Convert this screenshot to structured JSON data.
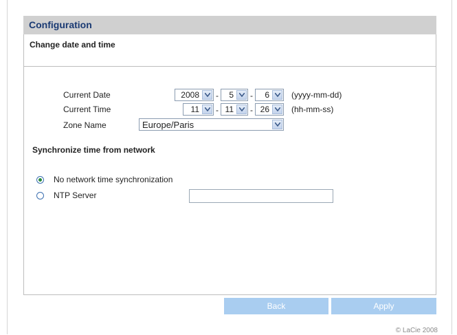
{
  "header": {
    "title": "Configuration"
  },
  "section": {
    "title": "Change date and time"
  },
  "date_time": {
    "current_date_label": "Current Date",
    "year": "2008",
    "month": "5",
    "day": "6",
    "date_format": "(yyyy-mm-dd)",
    "current_time_label": "Current Time",
    "hour": "11",
    "minute": "11",
    "second": "26",
    "time_format": "(hh-mm-ss)",
    "zone_label": "Zone Name",
    "zone_value": "Europe/Paris",
    "separator": "-"
  },
  "sync": {
    "title": "Synchronize time from network",
    "option_none": "No network time synchronization",
    "option_ntp": "NTP Server",
    "selected": "none",
    "ntp_value": ""
  },
  "buttons": {
    "back": "Back",
    "apply": "Apply"
  },
  "footer": {
    "copyright": "© LaCie 2008"
  },
  "colors": {
    "header_text": "#1a3a73",
    "header_bg": "#d0d0d0",
    "button_bg": "#a9cdf0",
    "radio_dot": "#2b8a3e"
  },
  "icons": {
    "select_arrow": "chevron-down-icon"
  }
}
